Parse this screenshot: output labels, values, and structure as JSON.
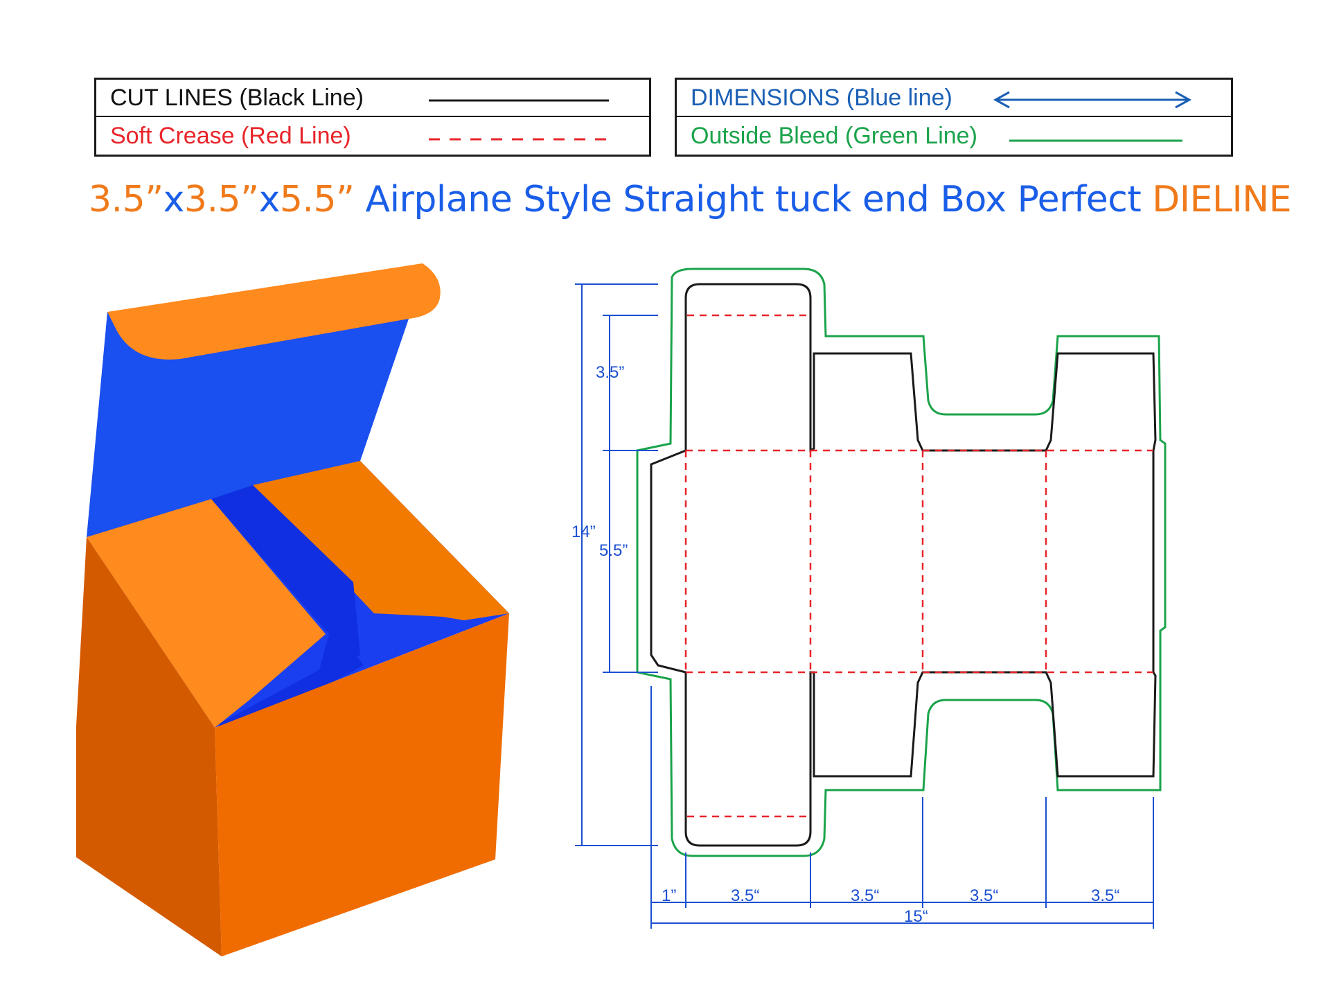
{
  "legend": {
    "cut_lines": "CUT LINES (Black Line)",
    "soft_crease": "Soft Crease (Red Line)",
    "dimensions": "DIMENSIONS (Blue line)",
    "outside_bleed": "Outside Bleed (Green Line)"
  },
  "title": {
    "part1": "3.5”",
    "part2": "x",
    "part3": "3.5”",
    "part4": "x",
    "part5": "5.5”",
    "part6": " Airplane Style Straight tuck end Box Perfect ",
    "part7": "DIELINE"
  },
  "dimensions": {
    "height_total": "14”",
    "tuck_flap": "3.5”",
    "body_height": "5.5”",
    "glue_flap": "1”",
    "panel1": "3.5“",
    "panel2": "3.5“",
    "panel3": "3.5“",
    "panel4": "3.5“",
    "total_width": "15“"
  },
  "colors": {
    "cut": "#1a1a1a",
    "crease": "#e8242a",
    "dimension": "#1a4fd1",
    "bleed": "#1aa34a",
    "title_orange": "#f07a1a",
    "title_blue": "#1a5ee8",
    "box_orange_front": "#f06c00",
    "box_orange_side": "#d45a00",
    "box_orange_flap": "#ff8a1e",
    "box_blue": "#1a4ff0",
    "box_blue_dark": "#0f2fe0"
  }
}
